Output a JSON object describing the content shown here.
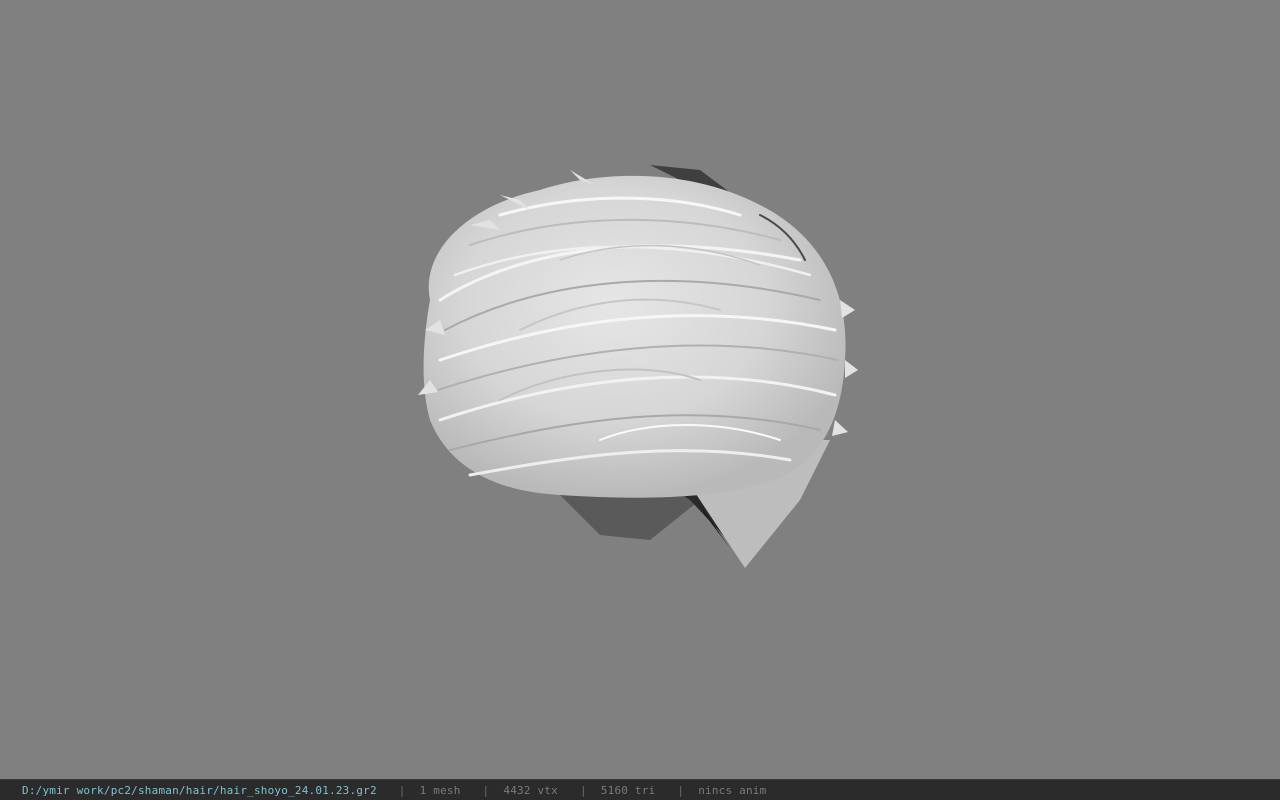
{
  "viewport": {
    "background_color": "#808080",
    "model": "hair-mesh"
  },
  "status_bar": {
    "file_path": "D:/ymir work/pc2/shaman/hair/hair_shoyo_24.01.23.gr2",
    "separator": "|",
    "mesh_count": "1 mesh",
    "vertex_count": "4432 vtx",
    "triangle_count": "5160 tri",
    "anim_status": "nincs anim"
  }
}
